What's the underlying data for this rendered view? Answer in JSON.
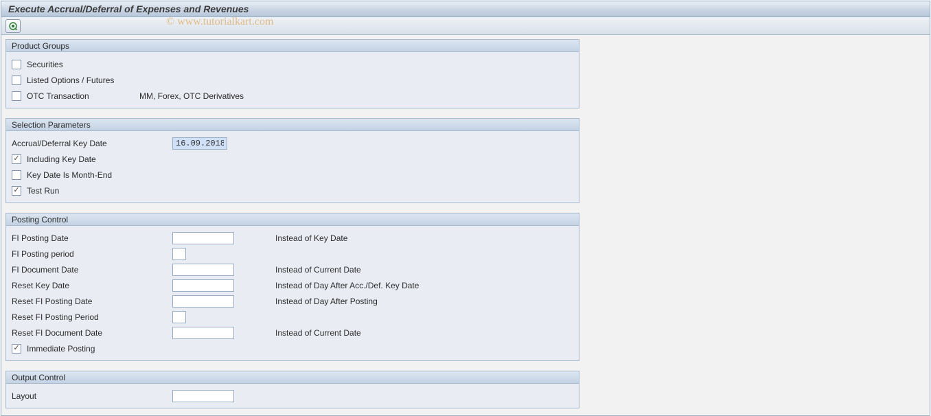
{
  "title": "Execute Accrual/Deferral of Expenses and Revenues",
  "watermark": "© www.tutorialkart.com",
  "groups": {
    "product": {
      "title": "Product Groups",
      "securities": "Securities",
      "listed": "Listed Options / Futures",
      "otc": "OTC Transaction",
      "otc_sub": "MM, Forex, OTC Derivatives"
    },
    "selection": {
      "title": "Selection Parameters",
      "keydate_label": "Accrual/Deferral Key Date",
      "keydate_value": "16.09.2018",
      "including": "Including Key Date",
      "monthend": "Key Date Is Month-End",
      "testrun": "Test Run"
    },
    "posting": {
      "title": "Posting Control",
      "fi_posting_date": "FI Posting Date",
      "fi_posting_date_hint": "Instead of Key Date",
      "fi_posting_period": "FI Posting period",
      "fi_doc_date": "FI Document Date",
      "fi_doc_date_hint": "Instead of Current Date",
      "reset_key_date": "Reset Key Date",
      "reset_key_date_hint": "Instead of Day After Acc./Def. Key Date",
      "reset_fi_posting_date": "Reset FI Posting Date",
      "reset_fi_posting_date_hint": "Instead of Day After Posting",
      "reset_fi_posting_period": "Reset FI Posting Period",
      "reset_fi_doc_date": "Reset FI Document Date",
      "reset_fi_doc_date_hint": "Instead of Current Date",
      "immediate": "Immediate Posting"
    },
    "output": {
      "title": "Output Control",
      "layout": "Layout"
    }
  },
  "checks": {
    "securities": false,
    "listed": false,
    "otc": false,
    "including": true,
    "monthend": false,
    "testrun": true,
    "immediate": true
  }
}
